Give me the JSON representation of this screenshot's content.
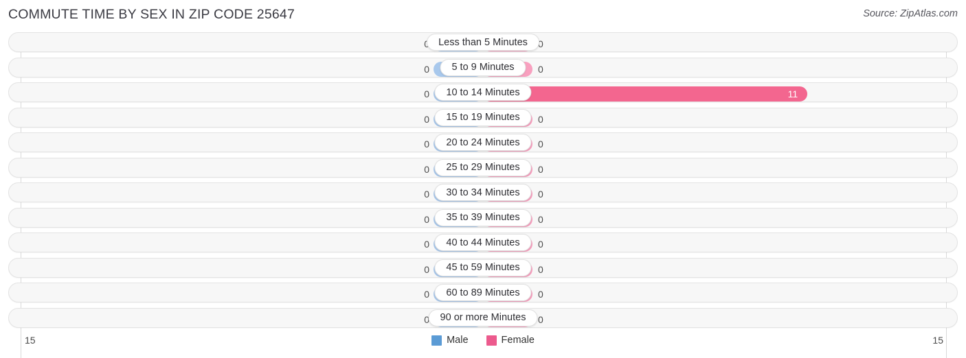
{
  "header": {
    "title": "COMMUTE TIME BY SEX IN ZIP CODE 25647",
    "source": "Source: ZipAtlas.com"
  },
  "legend": {
    "male_label": "Male",
    "female_label": "Female",
    "male_color": "#5b9bd5",
    "female_color": "#ec5a8d"
  },
  "axis": {
    "left_label": "15",
    "right_label": "15",
    "max": 15
  },
  "colors": {
    "bar_male": "#a8c8ec",
    "bar_female": "#f8a0bf",
    "bar_female_highlight": "#f3668f",
    "track_bg": "#f7f7f7",
    "track_border": "#e3e3e3"
  },
  "chart_data": {
    "type": "bar",
    "title": "COMMUTE TIME BY SEX IN ZIP CODE 25647",
    "subtitle": "Source: ZipAtlas.com",
    "orientation": "horizontal-diverging",
    "xlabel": "",
    "ylabel": "",
    "xlim": [
      15,
      15
    ],
    "grid": true,
    "legend_position": "bottom-center",
    "categories": [
      "Less than 5 Minutes",
      "5 to 9 Minutes",
      "10 to 14 Minutes",
      "15 to 19 Minutes",
      "20 to 24 Minutes",
      "25 to 29 Minutes",
      "30 to 34 Minutes",
      "35 to 39 Minutes",
      "40 to 44 Minutes",
      "45 to 59 Minutes",
      "60 to 89 Minutes",
      "90 or more Minutes"
    ],
    "series": [
      {
        "name": "Male",
        "values": [
          0,
          0,
          0,
          0,
          0,
          0,
          0,
          0,
          0,
          0,
          0,
          0
        ],
        "labels": [
          "0",
          "0",
          "0",
          "0",
          "0",
          "0",
          "0",
          "0",
          "0",
          "0",
          "0",
          "0"
        ]
      },
      {
        "name": "Female",
        "values": [
          0,
          0,
          11,
          0,
          0,
          0,
          0,
          0,
          0,
          0,
          0,
          0
        ],
        "labels": [
          "0",
          "0",
          "11",
          "0",
          "0",
          "0",
          "0",
          "0",
          "0",
          "0",
          "0",
          "0"
        ]
      }
    ]
  }
}
